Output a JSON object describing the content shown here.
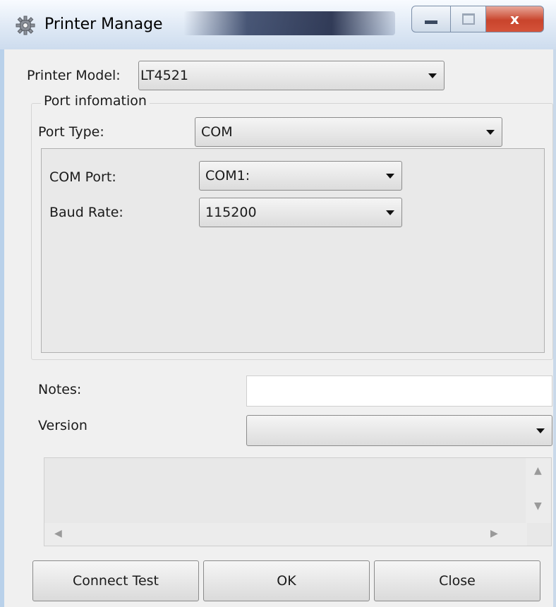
{
  "window": {
    "title": "Printer Manage",
    "icon": "gear-icon"
  },
  "caption_buttons": {
    "minimize": "minimize-icon",
    "maximize": "maximize-icon",
    "close": "x"
  },
  "printer_model": {
    "label": "Printer Model:",
    "value": "LT4521"
  },
  "port_group": {
    "title": "Port infomation",
    "port_type": {
      "label": "Port Type:",
      "value": "COM"
    },
    "com_port": {
      "label": "COM Port:",
      "value": "COM1:"
    },
    "baud_rate": {
      "label": "Baud Rate:",
      "value": "115200"
    }
  },
  "notes": {
    "label": "Notes:",
    "value": ""
  },
  "version": {
    "label": "Version",
    "value": ""
  },
  "buttons": {
    "connect_test": "Connect Test",
    "ok": "OK",
    "close": "Close"
  },
  "colors": {
    "title_glass": "#2d3c5f",
    "close_red": "#c9442c",
    "window_bg": "#f0f0f0"
  }
}
